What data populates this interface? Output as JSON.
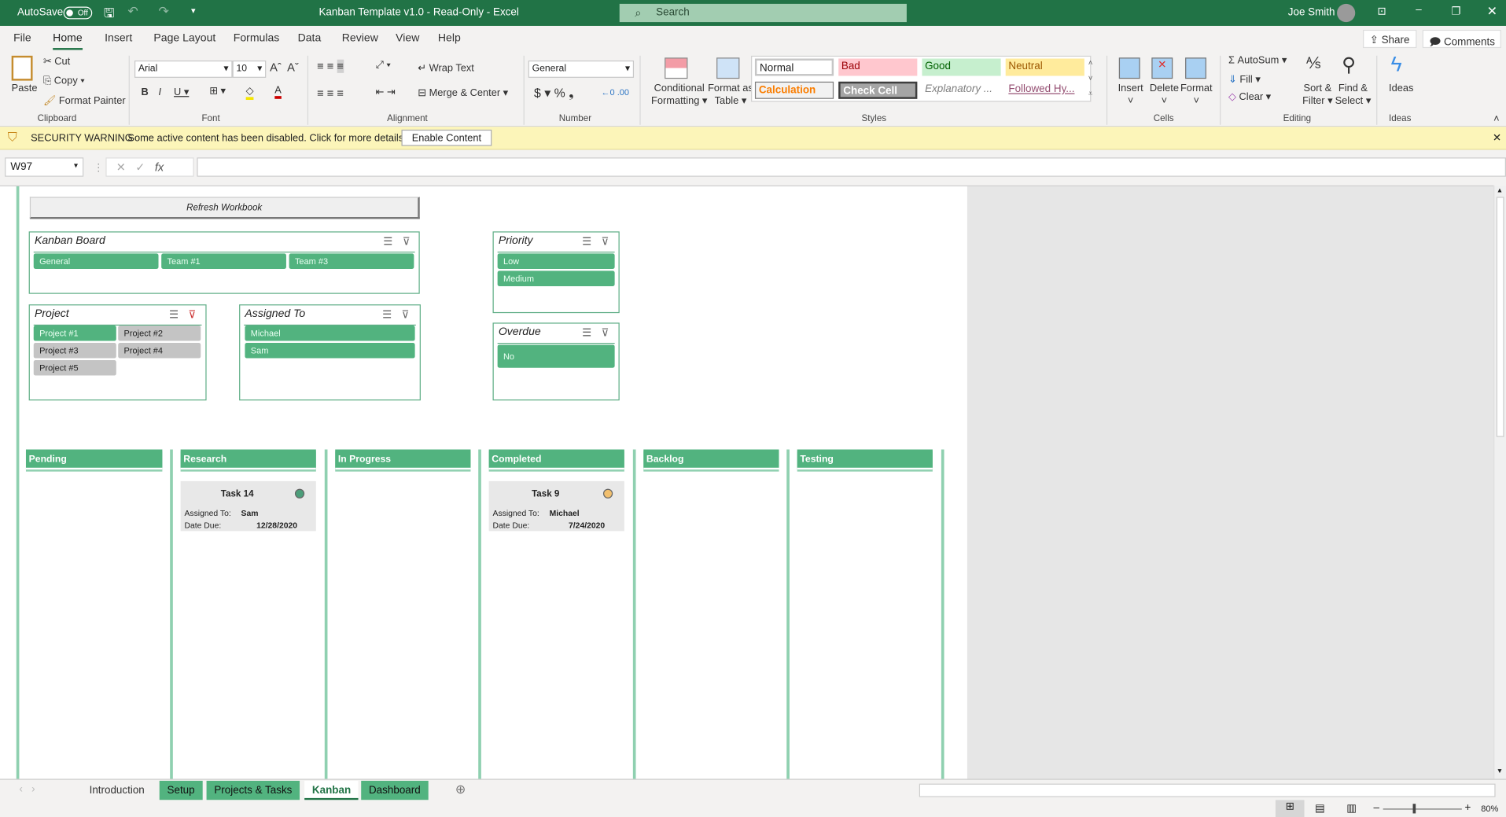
{
  "titlebar": {
    "autosave": "AutoSave",
    "autosave_state": "Off",
    "title": "Kanban Template v1.0  -  Read-Only  -  Excel",
    "search": "Search",
    "user": "Joe Smith"
  },
  "menu": [
    "File",
    "Home",
    "Insert",
    "Page Layout",
    "Formulas",
    "Data",
    "Review",
    "View",
    "Help"
  ],
  "share": "Share",
  "comments": "Comments",
  "ribbon": {
    "paste": "Paste",
    "cut": "Cut",
    "copy": "Copy",
    "format_painter": "Format Painter",
    "clipboard": "Clipboard",
    "font_name": "Arial",
    "font_size": "10",
    "font": "Font",
    "wrap_text": "Wrap Text",
    "merge_center": "Merge & Center",
    "alignment": "Alignment",
    "number_format": "General",
    "number": "Number",
    "conditional": "Conditional",
    "formatting": "Formatting",
    "format_as": "Format as",
    "table": "Table",
    "styles": {
      "normal": "Normal",
      "bad": "Bad",
      "good": "Good",
      "neutral": "Neutral",
      "calculation": "Calculation",
      "check_cell": "Check Cell",
      "explanatory": "Explanatory ...",
      "followed": "Followed Hy..."
    },
    "styles_label": "Styles",
    "insert": "Insert",
    "delete": "Delete",
    "format": "Format",
    "cells": "Cells",
    "autosum": "AutoSum",
    "fill": "Fill",
    "clear": "Clear",
    "sort_filter_1": "Sort &",
    "sort_filter_2": "Filter",
    "find_1": "Find &",
    "find_2": "Select",
    "editing": "Editing",
    "ideas": "Ideas",
    "ideas_label": "Ideas"
  },
  "security": {
    "title": "SECURITY WARNING",
    "message": "Some active content has been disabled. Click for more details.",
    "button": "Enable Content"
  },
  "formula_bar": {
    "name_box": "W97",
    "formula": ""
  },
  "sheet": {
    "refresh": "Refresh Workbook",
    "slicers": {
      "kanban": {
        "title": "Kanban Board",
        "items": [
          "General",
          "Team #1",
          "Team #3"
        ]
      },
      "project": {
        "title": "Project",
        "items": [
          "Project #1",
          "Project #2",
          "Project #3",
          "Project #4",
          "Project #5"
        ]
      },
      "assigned": {
        "title": "Assigned To",
        "items": [
          "Michael",
          "Sam"
        ]
      },
      "priority": {
        "title": "Priority",
        "items": [
          "Low",
          "Medium"
        ]
      },
      "overdue": {
        "title": "Overdue",
        "items": [
          "No"
        ]
      }
    },
    "columns": [
      "Pending",
      "Research",
      "In Progress",
      "Completed",
      "Backlog",
      "Testing"
    ],
    "cards": [
      {
        "title": "Task 14",
        "assigned_label": "Assigned To:",
        "assigned": "Sam",
        "due_label": "Date Due:",
        "due": "12/28/2020",
        "color": "#4c9e7a"
      },
      {
        "title": "Task 9",
        "assigned_label": "Assigned To:",
        "assigned": "Michael",
        "due_label": "Date Due:",
        "due": "7/24/2020",
        "color": "#f1bf6e"
      }
    ]
  },
  "sheet_tabs": [
    "Introduction",
    "Setup",
    "Projects & Tasks",
    "Kanban",
    "Dashboard"
  ],
  "zoom": "80%"
}
